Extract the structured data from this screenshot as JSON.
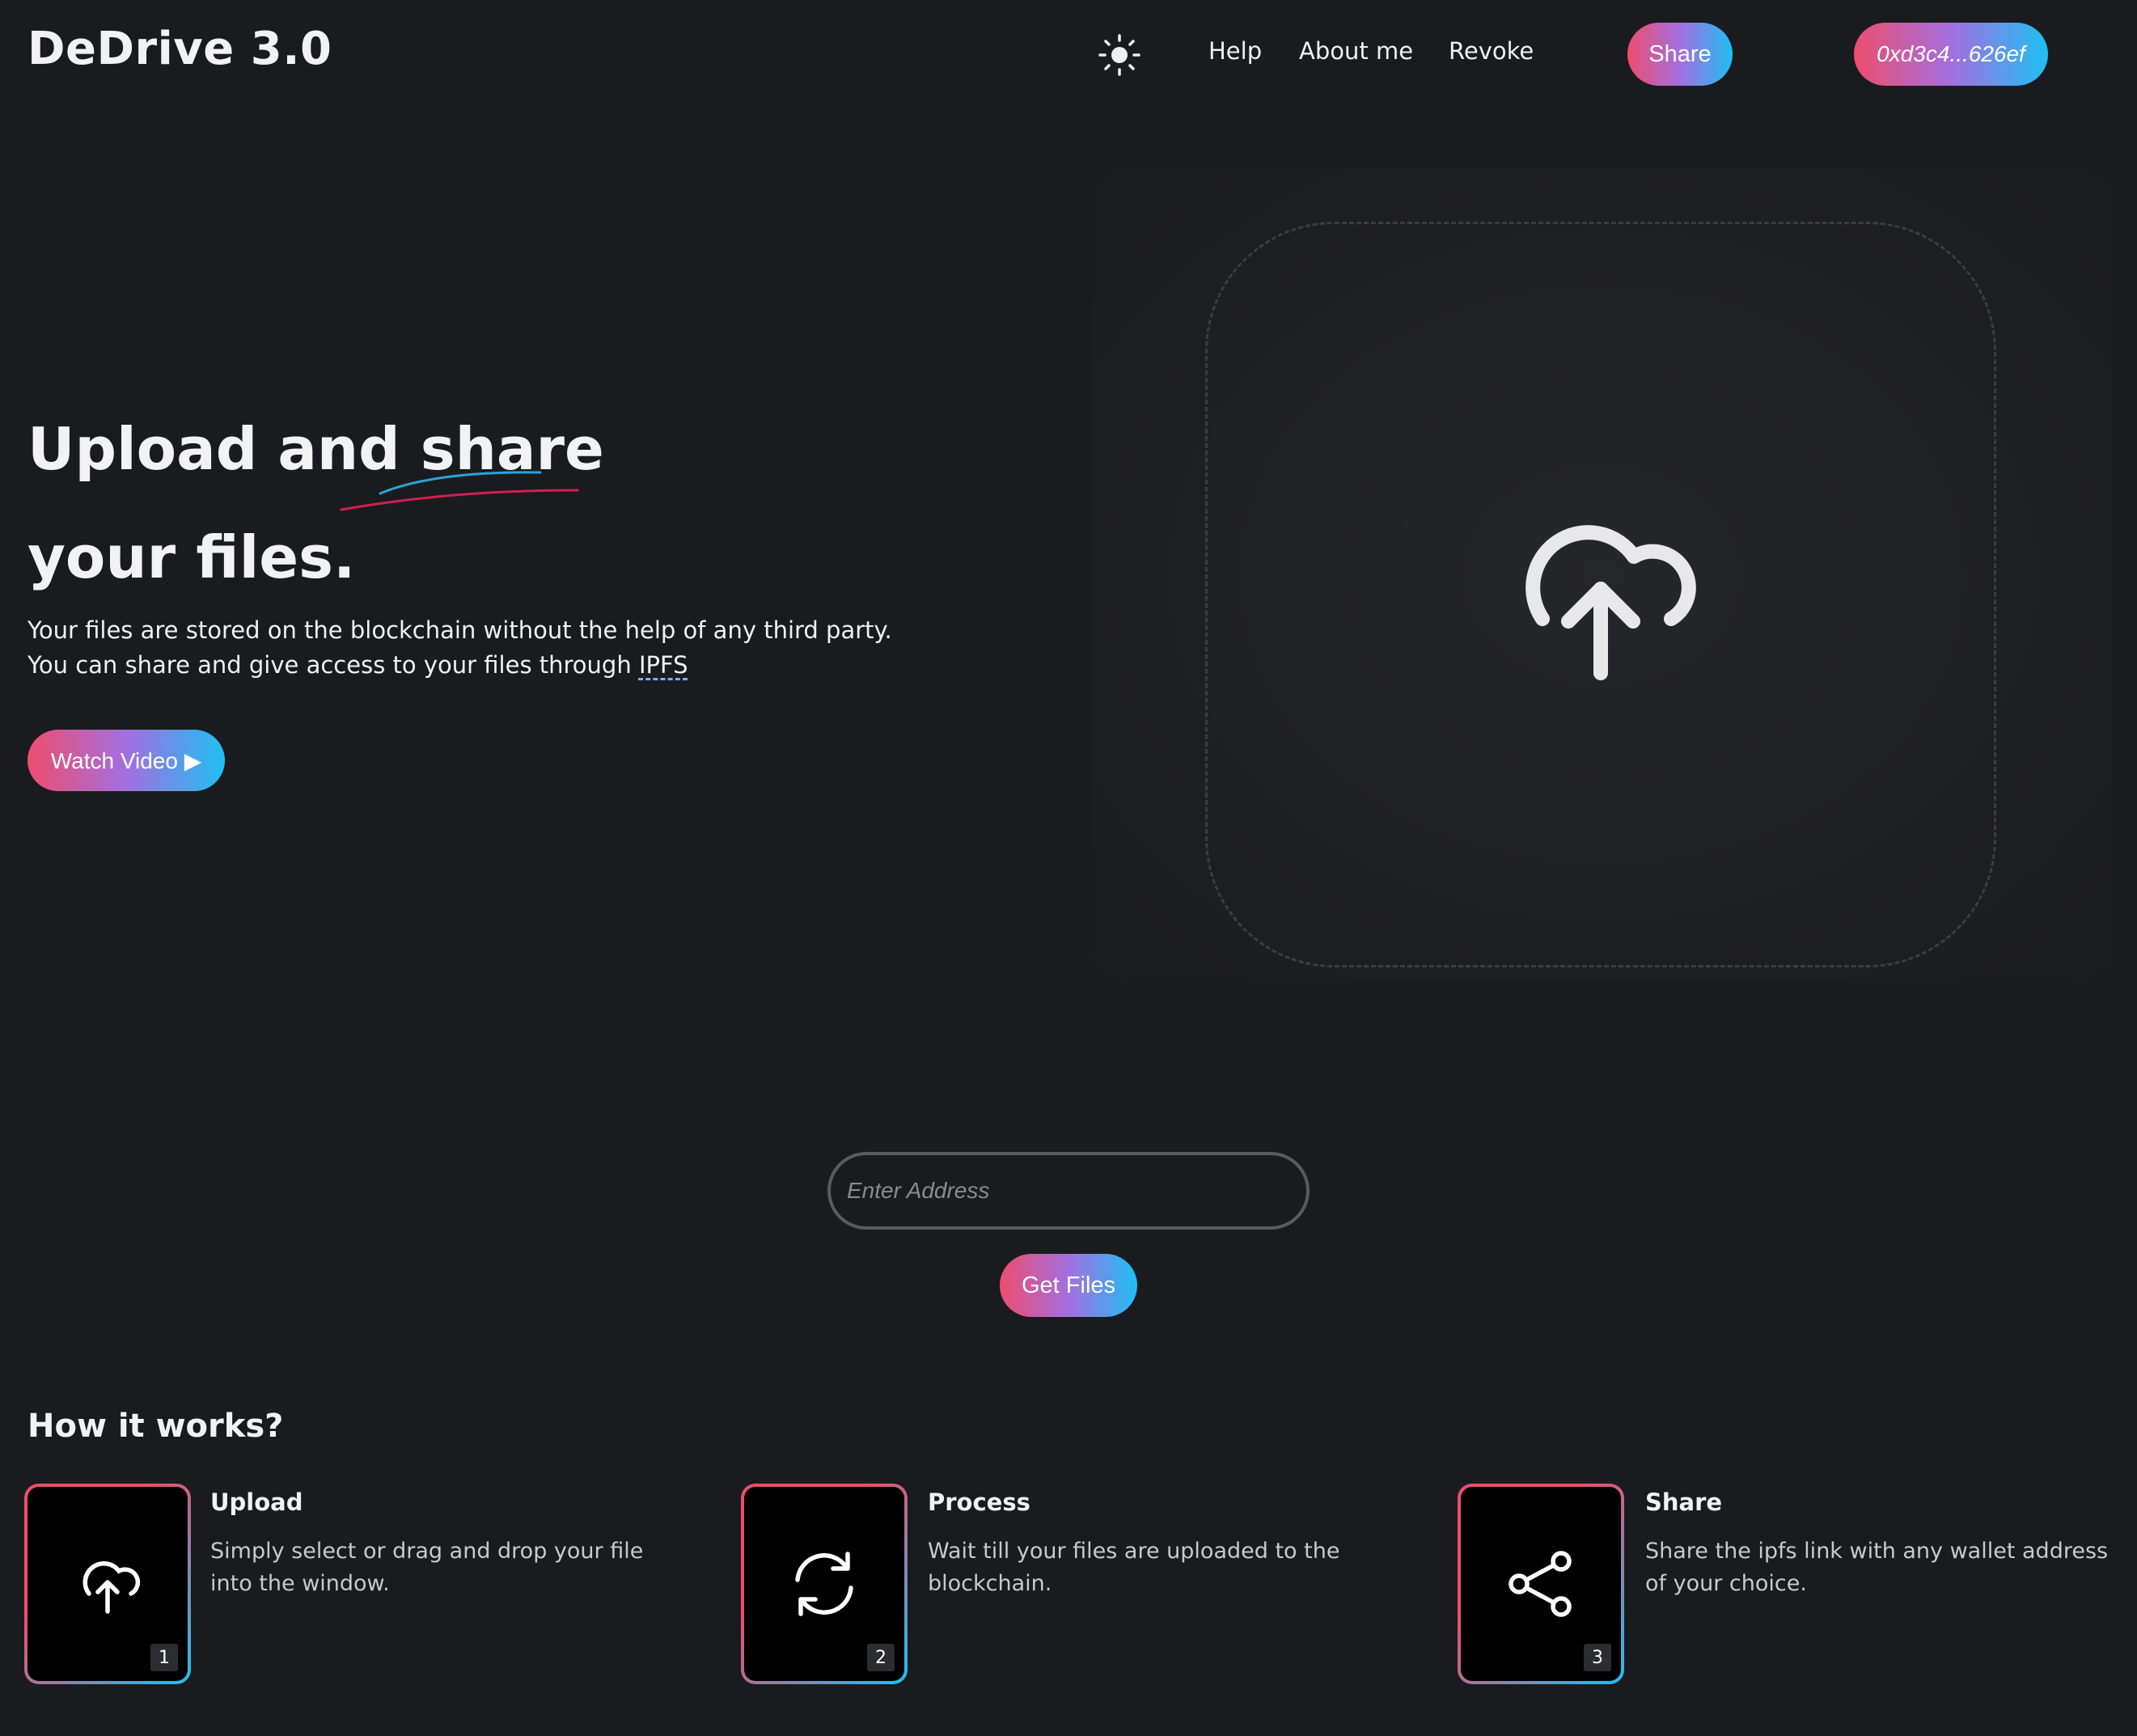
{
  "header": {
    "brand": "DeDrive 3.0",
    "theme_icon": "sun-icon",
    "nav": {
      "help": "Help",
      "about": "About me",
      "revoke": "Revoke"
    },
    "share_label": "Share",
    "wallet_label": "0xd3c4...626ef"
  },
  "hero": {
    "title_line1": "Upload and share",
    "title_line2": "your files.",
    "desc_line1": "Your files are stored on the blockchain without the help of any third party.",
    "desc_line2_prefix": "You can share and give access to your files through ",
    "desc_link": "IPFS",
    "watch_label": "Watch Video ▶"
  },
  "upload": {
    "icon": "cloud-upload-icon"
  },
  "fetch": {
    "placeholder": "Enter Address",
    "button_label": "Get Files"
  },
  "how": {
    "title": "How it works?",
    "steps": [
      {
        "icon": "cloud-upload-icon",
        "number": "1",
        "title": "Upload",
        "desc": "Simply select or drag and drop your file into the window."
      },
      {
        "icon": "refresh-icon",
        "number": "2",
        "title": "Process",
        "desc": "Wait till your files are uploaded to the blockchain."
      },
      {
        "icon": "share-icon",
        "number": "3",
        "title": "Share",
        "desc": "Share the ipfs link with any wallet address of your choice."
      }
    ]
  },
  "colors": {
    "background": "#1a1b1f",
    "gradient_start": "#ee4d6d",
    "gradient_end": "#1ec0f2"
  }
}
